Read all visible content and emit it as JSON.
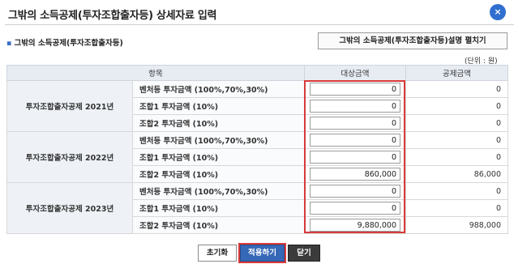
{
  "title": "그밖의 소득공제(투자조합출자등) 상세자료 입력",
  "close_icon": "×",
  "section": {
    "title": "그밖의 소득공제(투자조합출자등)",
    "expand_button": "그밖의 소득공제(투자조합출자등)설명 펼치기",
    "unit": "(단위 : 원)"
  },
  "table": {
    "headers": {
      "item": "항목",
      "target": "대상금액",
      "deduction": "공제금액"
    },
    "groups": [
      {
        "label": "투자조합출자공제 2021년",
        "rows": [
          {
            "item": "벤처등 투자금액 (100%,70%,30%)",
            "target": "0",
            "deduction": "0"
          },
          {
            "item": "조합1 투자금액 (10%)",
            "target": "0",
            "deduction": "0"
          },
          {
            "item": "조합2 투자금액 (10%)",
            "target": "0",
            "deduction": "0"
          }
        ]
      },
      {
        "label": "투자조합출자공제 2022년",
        "rows": [
          {
            "item": "벤처등 투자금액 (100%,70%,30%)",
            "target": "0",
            "deduction": "0"
          },
          {
            "item": "조합1 투자금액 (10%)",
            "target": "0",
            "deduction": "0"
          },
          {
            "item": "조합2 투자금액 (10%)",
            "target": "860,000",
            "deduction": "86,000"
          }
        ]
      },
      {
        "label": "투자조합출자공제 2023년",
        "rows": [
          {
            "item": "벤처등 투자금액 (100%,70%,30%)",
            "target": "0",
            "deduction": "0"
          },
          {
            "item": "조합1 투자금액 (10%)",
            "target": "0",
            "deduction": "0"
          },
          {
            "item": "조합2 투자금액 (10%)",
            "target": "9,880,000",
            "deduction": "988,000"
          }
        ]
      }
    ]
  },
  "buttons": {
    "reset": "초기화",
    "apply": "적용하기",
    "close": "닫기"
  },
  "colors": {
    "accent": "#3668b8",
    "highlight": "#d93a3a",
    "header_bg": "#e7ecf3"
  }
}
